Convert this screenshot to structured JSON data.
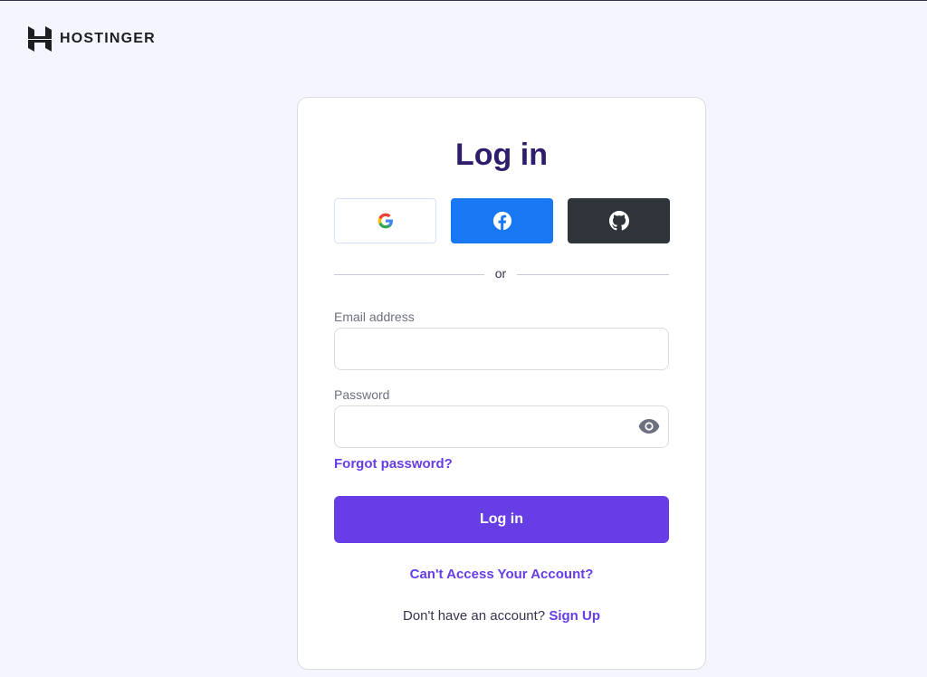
{
  "brand": {
    "name": "HOSTINGER"
  },
  "login": {
    "title": "Log in",
    "social": [
      {
        "provider": "google",
        "icon": "google-icon"
      },
      {
        "provider": "facebook",
        "icon": "facebook-icon"
      },
      {
        "provider": "github",
        "icon": "github-icon"
      }
    ],
    "divider": "or",
    "email": {
      "label": "Email address",
      "value": "",
      "placeholder": ""
    },
    "password": {
      "label": "Password",
      "value": "",
      "placeholder": "",
      "toggle_icon": "eye-icon"
    },
    "forgot_password": "Forgot password?",
    "submit_label": "Log in",
    "cant_access": "Can't Access Your Account?",
    "signup_prompt": "Don't have an account?",
    "signup_link": "Sign Up"
  },
  "colors": {
    "page_bg": "#f4f5ff",
    "accent": "#673de6",
    "title": "#2f1c6a",
    "facebook": "#1877f2",
    "github": "#2f343a"
  }
}
